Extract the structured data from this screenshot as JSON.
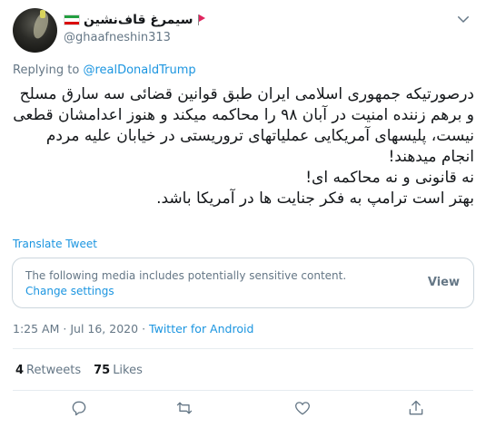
{
  "author": {
    "display_name": "سیمرغ قاف‌نشین",
    "handle": "@ghaafneshin313"
  },
  "reply": {
    "prefix": "Replying to",
    "to": "@realDonaldTrump"
  },
  "tweet_text": "درصورتیکه جمهوری اسلامی ایران طبق قوانین قضائی سه سارق مسلح و برهم زننده امنیت در آبان ۹۸ را محاکمه میکند و هنوز اعدامشان قطعی نیست، پلیسهای آمریکایی عملیاتهای تروریستی در خیابان علیه مردم انجام میدهند!\nنه قانونی و نه محاکمه ای!\nبهتر است ترامپ به فکر جنایت ها در آمریکا باشد.",
  "translate_label": "Translate Tweet",
  "sensitive": {
    "message": "The following media includes potentially sensitive content.",
    "change_settings": "Change settings",
    "view_label": "View"
  },
  "meta": {
    "time": "1:25 AM",
    "separator": "·",
    "date": "Jul 16, 2020",
    "source": "Twitter for Android"
  },
  "stats": {
    "retweets_count": "4",
    "retweets_label": "Retweets",
    "likes_count": "75",
    "likes_label": "Likes"
  },
  "icons": {
    "more": "chevron-down-icon",
    "reply": "reply-icon",
    "retweet": "retweet-icon",
    "like": "heart-icon",
    "share": "share-icon"
  },
  "colors": {
    "link": "#1b95e0",
    "muted": "#657786",
    "text": "#14171a",
    "border": "#ccd6dd"
  }
}
